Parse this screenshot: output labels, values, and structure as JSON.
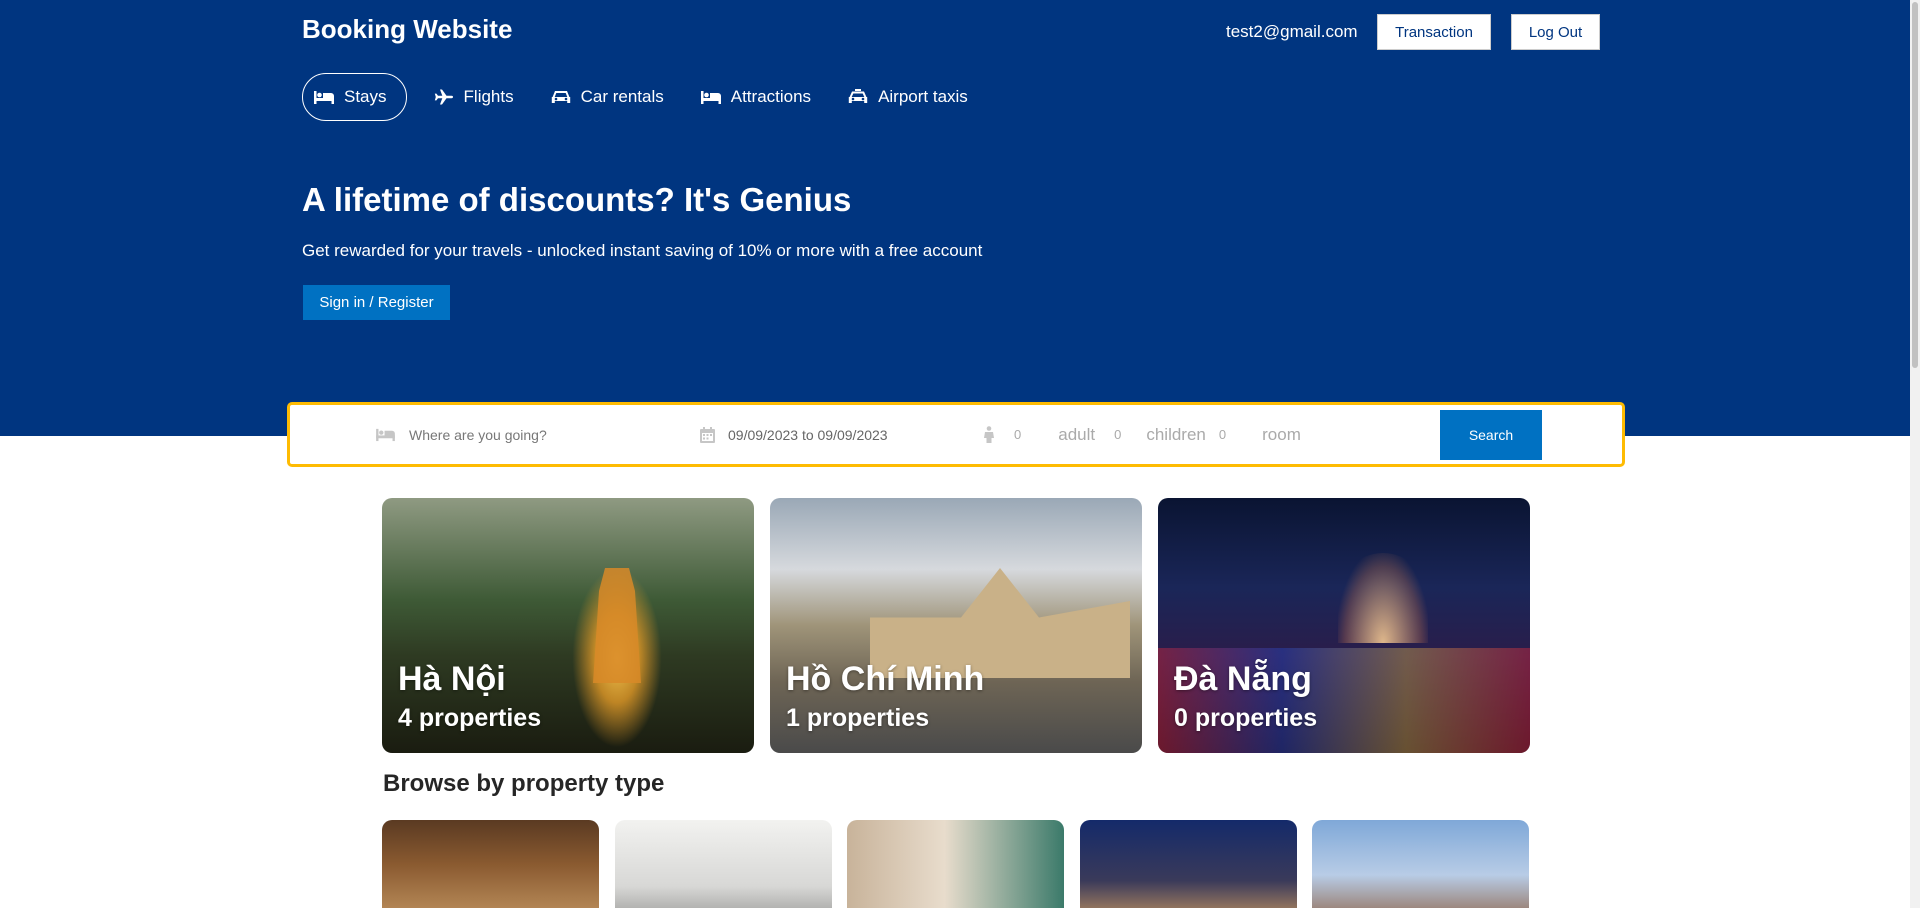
{
  "header": {
    "brand": "Booking Website",
    "user_email": "test2@gmail.com",
    "transaction_label": "Transaction",
    "logout_label": "Log Out"
  },
  "nav": [
    {
      "label": "Stays",
      "icon": "bed-icon",
      "active": true
    },
    {
      "label": "Flights",
      "icon": "plane-icon",
      "active": false
    },
    {
      "label": "Car rentals",
      "icon": "car-icon",
      "active": false
    },
    {
      "label": "Attractions",
      "icon": "bed-icon",
      "active": false
    },
    {
      "label": "Airport taxis",
      "icon": "taxi-icon",
      "active": false
    }
  ],
  "hero": {
    "title": "A lifetime of discounts? It's Genius",
    "subtitle": "Get rewarded for your travels - unlocked instant saving of 10% or more with a free account",
    "signin_label": "Sign in / Register"
  },
  "search": {
    "destination_placeholder": "Where are you going?",
    "date_range": "09/09/2023 to 09/09/2023",
    "adult_count": "0",
    "adult_label": "adult",
    "children_count": "0",
    "children_label": "children",
    "room_count": "0",
    "room_label": "room",
    "search_label": "Search"
  },
  "cities": [
    {
      "name": "Hà Nội",
      "properties": "4 properties"
    },
    {
      "name": "Hồ Chí Minh",
      "properties": "1 properties"
    },
    {
      "name": "Đà Nẵng",
      "properties": "0 properties"
    }
  ],
  "browse": {
    "title": "Browse by property type"
  },
  "colors": {
    "brand_blue": "#003580",
    "button_blue": "#0071c2",
    "search_border": "#febb02"
  }
}
